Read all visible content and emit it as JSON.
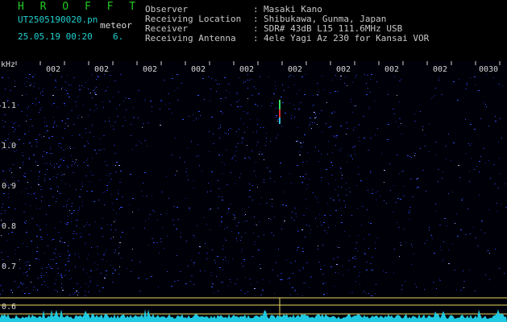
{
  "app": {
    "name": "H R O F F T"
  },
  "file": {
    "name": "UT2505190020.pn",
    "detect_label": "meteor",
    "datetime": "25.05.19 00:20",
    "count": "6."
  },
  "info": {
    "rows": [
      {
        "label": "Observer",
        "sep": ":",
        "value": "Masaki Kano"
      },
      {
        "label": "Receiving Location",
        "sep": ":",
        "value": "Shibukawa, Gunma, Japan"
      },
      {
        "label": "Receiver",
        "sep": ":",
        "value": "SDR# 43dB L15 111.6MHz USB"
      },
      {
        "label": "Receiving Antenna",
        "sep": ":",
        "value": "4ele Yagi Az 230 for Kansai VOR"
      }
    ]
  },
  "axis": {
    "unit": "kHz",
    "y_ticks": [
      "1.1",
      "1.0",
      "0.9",
      "0.8",
      "0.7",
      "0.6"
    ],
    "time_ticks": [
      "002",
      "002",
      "002",
      "002",
      "002",
      "002",
      "002",
      "002",
      "002",
      "0030"
    ]
  },
  "colors": {
    "background": "#000000",
    "title_green": "#22cc22",
    "header_cyan": "#20d0d0",
    "marker_yellow": "#e8d860",
    "noise_blue": "#2a3fe0",
    "bottom_cyan": "#20c8e0"
  }
}
